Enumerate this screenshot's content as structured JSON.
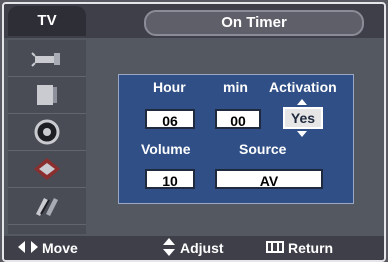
{
  "menu": {
    "category": "TV",
    "title": "On Timer"
  },
  "sidebar": {
    "items": [
      {
        "icon": "antenna-icon"
      },
      {
        "icon": "screen-icon"
      },
      {
        "icon": "speaker-icon"
      },
      {
        "icon": "chip-icon"
      },
      {
        "icon": "settings-icon"
      }
    ]
  },
  "on_timer": {
    "labels": {
      "hour": "Hour",
      "min": "min",
      "activation": "Activation",
      "volume": "Volume",
      "source": "Source"
    },
    "values": {
      "hour": "06",
      "min": "00",
      "activation": "Yes",
      "volume": "10",
      "source": "AV"
    }
  },
  "footer": {
    "move": "Move",
    "adjust": "Adjust",
    "return": "Return"
  }
}
